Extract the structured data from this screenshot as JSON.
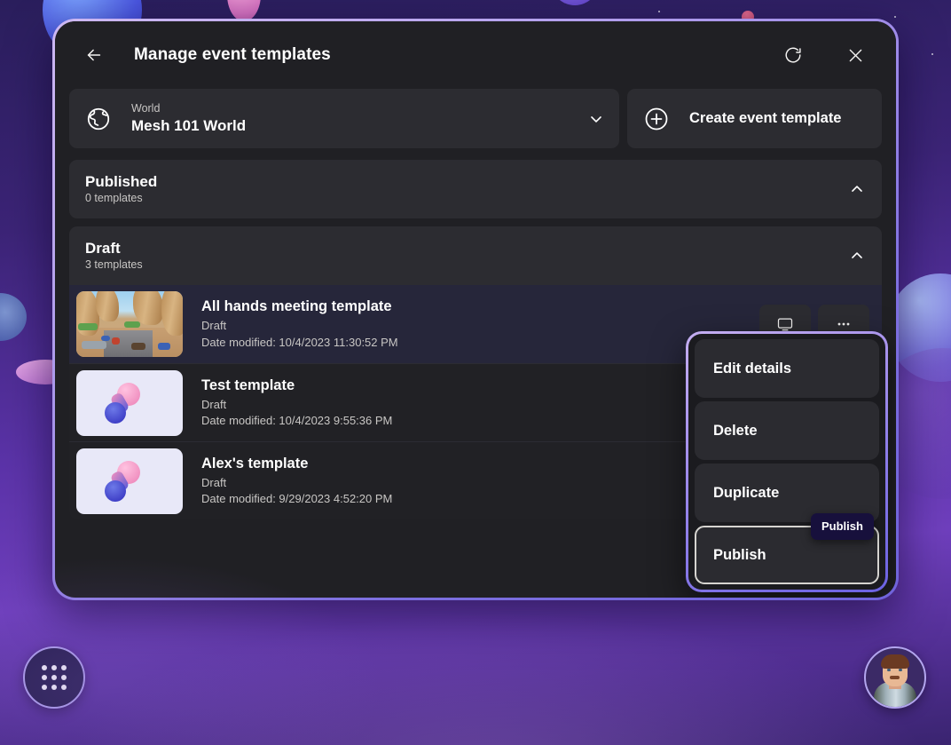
{
  "dialog": {
    "title": "Manage event templates",
    "back_icon": "arrow-left-icon",
    "refresh_icon": "refresh-icon",
    "close_icon": "close-icon"
  },
  "world_selector": {
    "icon": "globe-icon",
    "label": "World",
    "value": "Mesh 101 World",
    "chevron": "chevron-down-icon"
  },
  "create_button": {
    "icon": "plus-circle-icon",
    "label": "Create event template"
  },
  "sections": [
    {
      "title": "Published",
      "count_label": "0 templates",
      "chevron": "chevron-up-icon",
      "templates": []
    },
    {
      "title": "Draft",
      "count_label": "3 templates",
      "chevron": "chevron-up-icon",
      "templates": [
        {
          "name": "All hands meeting template",
          "status": "Draft",
          "date": "Date modified: 10/4/2023 11:30:52 PM",
          "thumbnail": "scene3d"
        },
        {
          "name": "Test template",
          "status": "Draft",
          "date": "Date modified: 10/4/2023 9:55:36 PM",
          "thumbnail": "mesh-logo"
        },
        {
          "name": "Alex's template",
          "status": "Draft",
          "date": "Date modified: 9/29/2023 4:52:20 PM",
          "thumbnail": "mesh-logo"
        }
      ]
    }
  ],
  "row_actions": {
    "join_icon": "monitor-icon",
    "more_icon": "more-icon"
  },
  "context_menu": {
    "items": [
      {
        "label": "Edit details"
      },
      {
        "label": "Delete"
      },
      {
        "label": "Duplicate"
      },
      {
        "label": "Publish"
      }
    ],
    "focused_index": 3,
    "tooltip": "Publish"
  },
  "taskbar": {
    "app_launcher_icon": "grid-dots-icon",
    "avatar_icon": "avatar"
  },
  "colors": {
    "dialog_border": "#b9a6ee",
    "dialog_bg": "#202024",
    "surface": "#2c2c31",
    "menu_bg": "#1b1b1f",
    "tooltip_bg": "#17103c",
    "accent": "#7d6fe0",
    "text_primary": "#ffffff",
    "text_secondary": "#c8c6c4",
    "row_active": "#26263a"
  }
}
